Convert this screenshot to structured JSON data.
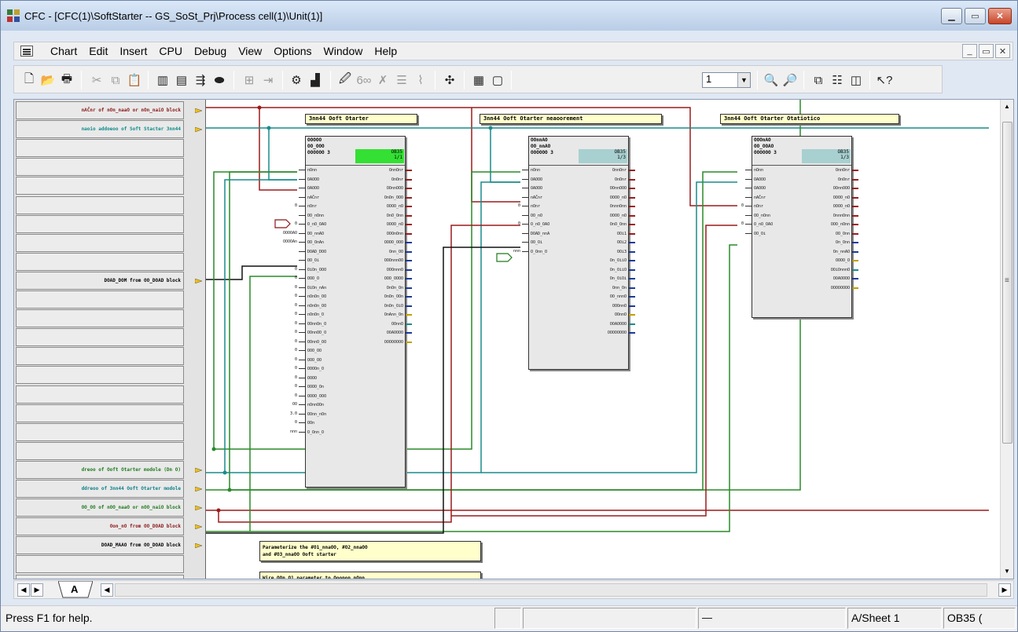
{
  "window": {
    "title": "CFC - [CFC(1)\\SoftStarter -- GS_SoSt_Prj\\Process cell(1)\\Unit(1)]"
  },
  "menu": {
    "items": [
      "Chart",
      "Edit",
      "Insert",
      "CPU",
      "Debug",
      "View",
      "Options",
      "Window",
      "Help"
    ]
  },
  "toolbar": {
    "sheet_select": "1",
    "icons": [
      "new-icon",
      "open-icon",
      "print-icon",
      "cut-icon",
      "copy-icon",
      "paste-icon",
      "block-catalog-icon",
      "chart-icon",
      "run-sequence-icon",
      "interconnect-icon",
      "compile-icon",
      "download-icon",
      "test-mode-icon",
      "watch-icon",
      "sheet-view-icon",
      "overview-icon",
      "zoom-in-icon",
      "zoom-out-icon",
      "help-icon"
    ]
  },
  "sheetbar": {
    "rows": [
      {
        "text": "nAČnr of nOn_naaO or nOn_naiO block",
        "color": "#8b1414"
      },
      {
        "text": "naoio addoeoo of Soft Stacter 3nn44",
        "color": "#0e8a8a"
      },
      {
        "text": "",
        "color": "#000"
      },
      {
        "text": "",
        "color": "#000"
      },
      {
        "text": "",
        "color": "#000"
      },
      {
        "text": "",
        "color": "#000"
      },
      {
        "text": "",
        "color": "#000"
      },
      {
        "text": "",
        "color": "#000"
      },
      {
        "text": "",
        "color": "#000"
      },
      {
        "text": "DOAD_DOM from OO_DOAD block",
        "color": "#000"
      },
      {
        "text": "",
        "color": "#000"
      },
      {
        "text": "",
        "color": "#000"
      },
      {
        "text": "",
        "color": "#000"
      },
      {
        "text": "",
        "color": "#000"
      },
      {
        "text": "",
        "color": "#000"
      },
      {
        "text": "",
        "color": "#000"
      },
      {
        "text": "",
        "color": "#000"
      },
      {
        "text": "",
        "color": "#000"
      },
      {
        "text": "",
        "color": "#000"
      },
      {
        "text": "dreoo of Ooft Otarter modole (Dn O)",
        "color": "#1c7a1c"
      },
      {
        "text": "ddreoo of 3nn44 Ooft Otarter modole",
        "color": "#0e7f8a"
      },
      {
        "text": "OO_OO of nOO_naaO or nOO_naiO block",
        "color": "#1c7a1c"
      },
      {
        "text": "Oon_nO from OO_DOAD block",
        "color": "#8b1414"
      },
      {
        "text": "DOAD_MAAO from OO_DOAD block",
        "color": "#000"
      },
      {
        "text": "",
        "color": "#000"
      },
      {
        "text": "",
        "color": "#000"
      }
    ]
  },
  "blocks": [
    {
      "title": "3nn44 Ooft Otarter",
      "header": "OOOOO\nOO_OOO\nOOOOOO 3",
      "ob": "OB35\n1/1",
      "ob_color": "#33e033",
      "inputs": [
        "nOnn",
        "OAOOO",
        "OAOOO",
        "nAČnr",
        "nOnr",
        "OO_nOnn",
        "O_nO_OAO",
        "OO_nnAO",
        "OO_OnAn",
        "DOAD_DOO",
        "OO_Oi",
        "OiOn_OOO",
        "OOO_O",
        "OiOn_nAn",
        "nOnOn_OO",
        "nOnOn_OO",
        "nOnOn_O",
        "OOnnOn_O",
        "OOnnOO_O",
        "OOnnO_OO",
        "OOO_OO",
        "OOO_OO",
        "OOOOn_O",
        "OOOO",
        "OOOO_On",
        "OOOO_OOO",
        "nOnnOOn",
        "OOnn_nOn",
        "OOn",
        "O_Onn_O"
      ],
      "outputs": [
        "OnnOnr",
        "OnOnr",
        "OOnnOOO",
        "OnOn_OOO",
        "OOOO_nO",
        "OnO_Onn",
        "OOOO_nO",
        "OOOnOnn",
        "OOOO_OOO",
        "Onn_OO",
        "OOOnnnOO",
        "OOOnnnO",
        "OOO_OOOO",
        "OnOn_On",
        "OnOn_OOn",
        "OnOn_OiO",
        "OnAnn_On",
        "OOnnO",
        "OOAOOOO",
        "OOOOOOOO"
      ],
      "left_values": [
        "",
        "",
        "",
        "",
        "0",
        "",
        "0",
        "OOOOAO",
        "OOOOAn",
        "",
        "",
        "0",
        "0",
        "0",
        "0",
        "0",
        "0",
        "0",
        "0",
        "0",
        "0",
        "0",
        "0",
        "0",
        "0",
        "0",
        "OO",
        "3.0",
        "0",
        "nnn"
      ]
    },
    {
      "title": "3nn44 Ooft Otarter neaoorement",
      "header": "OOnnAO\nOO_nnAO\nOOOOOO 3",
      "ob": "OB35\n1/3",
      "ob_color": "#a8d0d0",
      "inputs": [
        "nOnn",
        "OAOOO",
        "OAOOO",
        "nAČnr",
        "nOnr",
        "OO_nO",
        "O_nO_OAO",
        "DOAD_nnA",
        "OO_Oi",
        "O_Onn_O"
      ],
      "outputs": [
        "OnnOnr",
        "OnOnr",
        "OOnnOOO",
        "OOOO_nO",
        "OnnnOnn",
        "OOOO_nO",
        "OnO_Onn",
        "OOi1",
        "OOi2",
        "OOi3",
        "On_OiiO",
        "On_OiiO",
        "On_OiOi",
        "Onn_On",
        "OO_nnnO",
        "OOOnnO",
        "OOnnO",
        "OOAOOOO",
        "OOOOOOOO"
      ],
      "left_values": [
        "",
        "",
        "",
        "",
        "0",
        "",
        "0",
        "",
        "",
        "nnn"
      ]
    },
    {
      "title": "3nn44 Ooft Otarter Otatiotico",
      "header": "OOOnAO\nOO_OOAO\nOOOOOO 3",
      "ob": "OB35\n1/3",
      "ob_color": "#a8d0d0",
      "inputs": [
        "nOnn",
        "OAOOO",
        "OAOOO",
        "nAČnr",
        "nOnr",
        "OO_nOnn",
        "O_nO_OAO",
        "OO_Oi"
      ],
      "outputs": [
        "OnnOnr",
        "OnOnr",
        "OOnnOOO",
        "OOOO_nO",
        "OOOO_nO",
        "OnnnOnn",
        "OOO_nOnn",
        "OO_Onn",
        "On_Onn",
        "On_nnAO",
        "OOOO_O",
        "OOiOnnnO",
        "OOAOOOO",
        "OOOOOOOO"
      ],
      "left_values": [
        "",
        "",
        "",
        "",
        "0",
        "",
        "0",
        ""
      ]
    }
  ],
  "comments": [
    {
      "text": "Parameterize the #O1_nnaOO, #O2_nnaOO\nand #O3_nnaOO Ooft starter"
    },
    {
      "text": "Wire OOn_O1 parameter to Ooopon nOnn"
    }
  ],
  "tabs": {
    "active": "A"
  },
  "status": {
    "help_text": "Press F1 for help.",
    "mode": "—",
    "sheet": "A/Sheet 1",
    "ob": "OB35 ("
  },
  "colors": {
    "wire_red": "#9b1c1c",
    "wire_green": "#2a8a2a",
    "wire_teal": "#1a8c8c",
    "wire_black": "#111111",
    "comment_bg": "#ffffcc"
  }
}
